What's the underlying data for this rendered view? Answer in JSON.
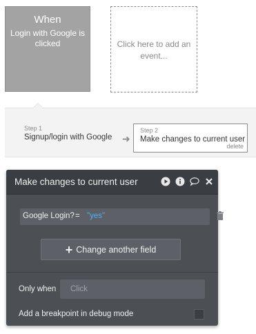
{
  "event": {
    "heading": "When",
    "description": "Login with Google is clicked"
  },
  "add_event": {
    "label": "Click here to add an event..."
  },
  "steps": [
    {
      "number_label": "Step 1",
      "title": "Signup/login with Google"
    },
    {
      "number_label": "Step 2",
      "title": "Make changes to current user",
      "delete_label": "delete"
    }
  ],
  "panel": {
    "title": "Make changes to current user",
    "icons": [
      "play-icon",
      "info-icon",
      "comment-icon",
      "close-icon"
    ],
    "field": {
      "label": "Google Login?",
      "operator": "=",
      "value": "\"yes\""
    },
    "change_button_label": "Change another field",
    "only_when": {
      "label": "Only when",
      "placeholder": "Click"
    },
    "breakpoint_label": "Add a breakpoint in debug mode"
  },
  "colors": {
    "event_card": "#a3a3a3",
    "panel_bg": "#4c4f54",
    "panel_header": "#3a3d42",
    "value_text": "#4db3f2"
  }
}
